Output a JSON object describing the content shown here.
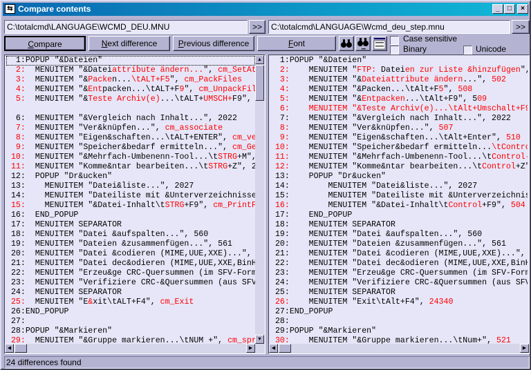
{
  "window": {
    "title": "Compare contents",
    "icon": "compare-app-icon",
    "controls": [
      "_",
      "□",
      "×"
    ]
  },
  "paths": {
    "left": "C:\\totalcmd\\LANGUAGE\\WCMD_DEU.MNU",
    "right": "C:\\totalcmd\\LANGUAGE\\Wcmd_deu_step.mnu",
    "browse_label": ">>"
  },
  "toolbar": {
    "compare": {
      "key": "C",
      "rest": "ompare"
    },
    "next": {
      "key": "N",
      "rest": "ext difference"
    },
    "previous": {
      "key": "P",
      "rest": "revious difference"
    },
    "font": {
      "key": "F",
      "rest": "ont"
    },
    "icons": [
      "binoculars-find-icon",
      "binoculars-find-next-icon",
      "edit-compare-icon"
    ],
    "case_sensitive": {
      "label": "Case sensitive",
      "checked": false
    },
    "binary": {
      "label": "Binary",
      "checked": false
    },
    "unicode": {
      "label": "Unicode",
      "checked": false
    }
  },
  "diff_color": "#ff0000",
  "left_lines": [
    {
      "n": "  1:",
      "d": 0,
      "s": [
        [
          "POPUP \"&Dateien\"",
          0
        ]
      ]
    },
    {
      "n": "  2:",
      "d": 1,
      "s": [
        [
          "  MENUITEM \"&Datei",
          0
        ],
        [
          "attribute ändern...",
          1
        ],
        [
          "\", ",
          0
        ],
        [
          "cm_SetAttrib",
          1
        ]
      ]
    },
    {
      "n": "  3:",
      "d": 1,
      "s": [
        [
          "  MENUITEM \"&",
          0
        ],
        [
          "Packe",
          1
        ],
        [
          "n...",
          0
        ],
        [
          "\\tALT+F5",
          1
        ],
        [
          "\", ",
          0
        ],
        [
          "cm_PackFiles",
          1
        ]
      ]
    },
    {
      "n": "  4:",
      "d": 1,
      "s": [
        [
          "  MENUITEM \"&",
          0
        ],
        [
          "Ent",
          1
        ],
        [
          "packen...\\tALT+F",
          0
        ],
        [
          "9",
          1
        ],
        [
          "\", ",
          0
        ],
        [
          "cm_UnpackFiles",
          1
        ]
      ]
    },
    {
      "n": "  5:",
      "d": 1,
      "s": [
        [
          "  MENUITEM \"&",
          0
        ],
        [
          "Teste Archiv(e)",
          1
        ],
        [
          "...\\tALT+",
          0
        ],
        [
          "UMSCH+",
          1
        ],
        [
          "F9\", ",
          0
        ]
      ]
    },
    {
      "n": "",
      "d": 0,
      "s": []
    },
    {
      "n": "  6:",
      "d": 0,
      "s": [
        [
          "  MENUITEM \"&Vergleich nach Inhalt...\", 2022",
          0
        ]
      ]
    },
    {
      "n": "  7:",
      "d": 1,
      "s": [
        [
          "  MENUITEM \"Ver&knüpfen...\", ",
          0
        ],
        [
          "cm_associate",
          1
        ]
      ]
    },
    {
      "n": "  8:",
      "d": 1,
      "s": [
        [
          "  MENUITEM \"Eigen&schaften...\\tALT+ENTER\", ",
          0
        ],
        [
          "cm_ve",
          1
        ]
      ]
    },
    {
      "n": "  9:",
      "d": 1,
      "s": [
        [
          "  MENUITEM \"Speicher&bedarf ermitteln...\", ",
          0
        ],
        [
          "cm_Ge",
          1
        ]
      ]
    },
    {
      "n": " 10:",
      "d": 1,
      "s": [
        [
          "  MENUITEM \"&Mehrfach-Umbenenn-Tool...\\t",
          0
        ],
        [
          "STRG",
          1
        ],
        [
          "+M\",",
          0
        ]
      ]
    },
    {
      "n": " 11:",
      "d": 1,
      "s": [
        [
          "  MENUITEM \"Komme&ntar bearbeiten...\\t",
          0
        ],
        [
          "STRG",
          1
        ],
        [
          "+Z\", 2",
          0
        ]
      ]
    },
    {
      "n": " 12:",
      "d": 0,
      "s": [
        [
          "  POPUP \"Dr&ucken\"",
          0
        ]
      ]
    },
    {
      "n": " 13:",
      "d": 0,
      "s": [
        [
          "    MENUITEM \"Datei&liste...\", 2027",
          0
        ]
      ]
    },
    {
      "n": " 14:",
      "d": 0,
      "s": [
        [
          "    MENUITEM \"Dateiliste mit &Unterverzeichnisse",
          0
        ]
      ]
    },
    {
      "n": " 15:",
      "d": 1,
      "s": [
        [
          "    MENUITEM \"&Datei-Inhalt\\t",
          0
        ],
        [
          "STRG",
          1
        ],
        [
          "+F9\", ",
          0
        ],
        [
          "cm_PrintF",
          1
        ]
      ]
    },
    {
      "n": " 16:",
      "d": 0,
      "s": [
        [
          "  END_POPUP",
          0
        ]
      ]
    },
    {
      "n": " 17:",
      "d": 0,
      "s": [
        [
          "  MENUITEM SEPARATOR",
          0
        ]
      ]
    },
    {
      "n": " 18:",
      "d": 0,
      "s": [
        [
          "  MENUITEM \"Datei &aufspalten...\", 560",
          0
        ]
      ]
    },
    {
      "n": " 19:",
      "d": 0,
      "s": [
        [
          "  MENUITEM \"Dateien &zusammenfügen...\", 561",
          0
        ]
      ]
    },
    {
      "n": " 20:",
      "d": 0,
      "s": [
        [
          "  MENUITEM \"Datei &codieren (MIME,UUE,XXE)...\",",
          0
        ]
      ]
    },
    {
      "n": " 21:",
      "d": 0,
      "s": [
        [
          "  MENUITEM \"Datei dec&odieren (MIME,UUE,XXE,BinH",
          0
        ]
      ]
    },
    {
      "n": " 22:",
      "d": 0,
      "s": [
        [
          "  MENUITEM \"Erzeu&ge CRC-Quersummen (im SFV-Form",
          0
        ]
      ]
    },
    {
      "n": " 23:",
      "d": 0,
      "s": [
        [
          "  MENUITEM \"Verifiziere CRC-&Quersummen (aus SFV",
          0
        ]
      ]
    },
    {
      "n": " 24:",
      "d": 0,
      "s": [
        [
          "  MENUITEM SEPARATOR",
          0
        ]
      ]
    },
    {
      "n": " 25:",
      "d": 1,
      "s": [
        [
          "  MENUITEM \"E",
          0
        ],
        [
          "&",
          1
        ],
        [
          "xit\\tALT+F4\", ",
          0
        ],
        [
          "cm_Exit",
          1
        ]
      ]
    },
    {
      "n": " 26:",
      "d": 0,
      "s": [
        [
          "END_POPUP",
          0
        ]
      ]
    },
    {
      "n": " 27:",
      "d": 0,
      "s": []
    },
    {
      "n": " 28:",
      "d": 0,
      "s": [
        [
          "POPUP \"&Markieren\"",
          0
        ]
      ]
    },
    {
      "n": " 29:",
      "d": 1,
      "s": [
        [
          "  MENUITEM \"&Gruppe markieren...\\tNUM +\", ",
          0
        ],
        [
          "cm_spr",
          1
        ]
      ]
    }
  ],
  "right_lines": [
    {
      "n": "  1:",
      "d": 0,
      "s": [
        [
          "POPUP \"&Dateien\"",
          0
        ]
      ]
    },
    {
      "n": "  2:",
      "d": 1,
      "s": [
        [
          "    MENUITEM \"",
          0
        ],
        [
          "FTP:",
          1
        ],
        [
          " Datei",
          0
        ],
        [
          "en zur Liste &hinzufügen",
          1
        ],
        [
          "\",",
          0
        ]
      ]
    },
    {
      "n": "  3:",
      "d": 1,
      "s": [
        [
          "    MENUITEM \"&",
          0
        ],
        [
          "Dateiattribute ändern",
          1
        ],
        [
          "...\", ",
          0
        ],
        [
          "502",
          1
        ]
      ]
    },
    {
      "n": "  4:",
      "d": 1,
      "s": [
        [
          "    MENUITEM \"&Packen...\\tAlt+F",
          0
        ],
        [
          "5",
          1
        ],
        [
          "\", ",
          0
        ],
        [
          "508",
          1
        ]
      ]
    },
    {
      "n": "  5:",
      "d": 1,
      "s": [
        [
          "    MENUITEM \"&",
          0
        ],
        [
          "Entpacken",
          1
        ],
        [
          "...\\tAlt+F9\", 5",
          0
        ],
        [
          "09",
          1
        ]
      ]
    },
    {
      "n": "  6:",
      "d": 1,
      "s": [
        [
          "    MENUITEM \"&Teste Archiv(e)...\\tAlt+Umschalt+F9",
          1
        ]
      ]
    },
    {
      "n": "  7:",
      "d": 0,
      "s": [
        [
          "    MENUITEM \"&Vergleich nach Inhalt...\", 2022",
          0
        ]
      ]
    },
    {
      "n": "  8:",
      "d": 1,
      "s": [
        [
          "    MENUITEM \"Ver&knüpfen...\", ",
          0
        ],
        [
          "507",
          1
        ]
      ]
    },
    {
      "n": "  9:",
      "d": 1,
      "s": [
        [
          "    MENUITEM \"Eigen&schaften...\\tAlt+Enter\", ",
          0
        ],
        [
          "510",
          1
        ]
      ]
    },
    {
      "n": " 10:",
      "d": 1,
      "s": [
        [
          "    MENUITEM \"Speicher&bedarf ermitteln...",
          0
        ],
        [
          "\\tControl",
          1
        ]
      ]
    },
    {
      "n": " 11:",
      "d": 1,
      "s": [
        [
          "    MENUITEM \"&Mehrfach-Umbenenn-Tool...\\t",
          0
        ],
        [
          "Control-",
          1
        ]
      ]
    },
    {
      "n": " 12:",
      "d": 1,
      "s": [
        [
          "    MENUITEM \"Komme&ntar bearbeiten...\\t",
          0
        ],
        [
          "Control",
          1
        ],
        [
          "+Z\"",
          0
        ]
      ]
    },
    {
      "n": " 13:",
      "d": 0,
      "s": [
        [
          "    POPUP \"Dr&ucken\"",
          0
        ]
      ]
    },
    {
      "n": " 14:",
      "d": 0,
      "s": [
        [
          "        MENUITEM \"Datei&liste...\", 2027",
          0
        ]
      ]
    },
    {
      "n": " 15:",
      "d": 0,
      "s": [
        [
          "        MENUITEM \"Dateiliste mit &Unterverzeichnis",
          0
        ]
      ]
    },
    {
      "n": " 16:",
      "d": 1,
      "s": [
        [
          "        MENUITEM \"&Datei-Inhalt\\t",
          0
        ],
        [
          "Control",
          1
        ],
        [
          "+F9\", ",
          0
        ],
        [
          "504",
          1
        ]
      ]
    },
    {
      "n": " 17:",
      "d": 0,
      "s": [
        [
          "    END_POPUP",
          0
        ]
      ]
    },
    {
      "n": " 18:",
      "d": 0,
      "s": [
        [
          "    MENUITEM SEPARATOR",
          0
        ]
      ]
    },
    {
      "n": " 19:",
      "d": 0,
      "s": [
        [
          "    MENUITEM \"Datei &aufspalten...\", 560",
          0
        ]
      ]
    },
    {
      "n": " 20:",
      "d": 0,
      "s": [
        [
          "    MENUITEM \"Dateien &zusammenfügen...\", 561",
          0
        ]
      ]
    },
    {
      "n": " 21:",
      "d": 0,
      "s": [
        [
          "    MENUITEM \"Datei &codieren (MIME,UUE,XXE)...\",",
          0
        ]
      ]
    },
    {
      "n": " 22:",
      "d": 0,
      "s": [
        [
          "    MENUITEM \"Datei dec&odieren (MIME,UUE,XXE,BinH",
          0
        ]
      ]
    },
    {
      "n": " 23:",
      "d": 0,
      "s": [
        [
          "    MENUITEM \"Erzeu&ge CRC-Quersummen (im SFV-Form",
          0
        ]
      ]
    },
    {
      "n": " 24:",
      "d": 0,
      "s": [
        [
          "    MENUITEM \"Verifiziere CRC-&Quersummen (aus SFV",
          0
        ]
      ]
    },
    {
      "n": " 25:",
      "d": 0,
      "s": [
        [
          "    MENUITEM SEPARATOR",
          0
        ]
      ]
    },
    {
      "n": " 26:",
      "d": 1,
      "s": [
        [
          "    MENUITEM \"Exit\\tAlt+F4\", ",
          0
        ],
        [
          "24340",
          1
        ]
      ]
    },
    {
      "n": " 27:",
      "d": 0,
      "s": [
        [
          "END_POPUP",
          0
        ]
      ]
    },
    {
      "n": " 28:",
      "d": 0,
      "s": []
    },
    {
      "n": " 29:",
      "d": 0,
      "s": [
        [
          "POPUP \"&Markieren\"",
          0
        ]
      ]
    },
    {
      "n": " 30:",
      "d": 1,
      "s": [
        [
          "    MENUITEM \"&Gruppe markieren...\\tNum+\", ",
          0
        ],
        [
          "521",
          1
        ]
      ]
    }
  ],
  "status": "24 differences found"
}
